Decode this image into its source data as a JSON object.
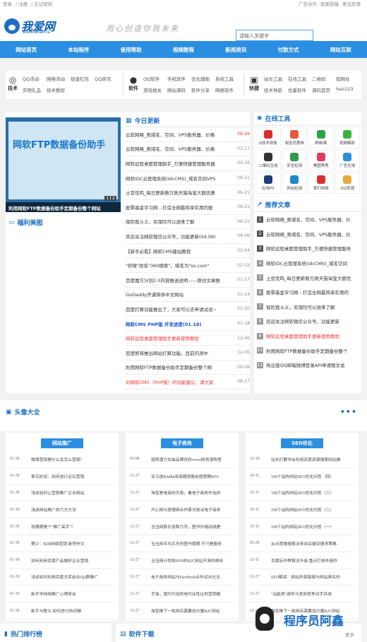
{
  "topbar": {
    "login": "登录",
    "register": "注册",
    "forgot": "忘记密码",
    "ad": "广告合作",
    "report": "我要投稿",
    "feedback": "意见反馈"
  },
  "header": {
    "brand": "我爱网",
    "url": "www.woail.la",
    "slogan": "用心创造你我未来",
    "search_placeholder": "请输入关键字"
  },
  "nav": [
    "网站首页",
    "本站程序",
    "使用帮助",
    "视频教程",
    "新闻资讯",
    "付款方式",
    "网站互联"
  ],
  "cats": [
    {
      "label": "技术",
      "links": [
        "QQ活动",
        "网络活动",
        "现金红包",
        "QQ资讯",
        "实物礼品",
        "技术教程"
      ]
    },
    {
      "label": "软件",
      "links": [
        "QQ软件",
        "手机软件",
        "优化辅助",
        "系统工具",
        "游戏相关",
        "网站源码",
        "软件分享",
        "网络软件"
      ]
    },
    {
      "label": "快捷",
      "links": [
        "站长工具",
        "在线工具",
        "二维码",
        "短网址",
        "技术导航",
        "优量软件",
        "源码首页",
        "hao123"
      ]
    }
  ],
  "slider": {
    "caption": "利用网软FTP数据备份助手定期备份整个网站",
    "banner1": "网软FTP数据备份助手",
    "dots": [
      "1",
      "2"
    ]
  },
  "news": {
    "title": "今日更新",
    "items": [
      {
        "t": "云软网络_奥域名、空间、VPS服务器、价格",
        "d": "08-26",
        "cls": "red"
      },
      {
        "t": "云软网络_奥域名、空间、VPS服务器、价格",
        "d": "03-17",
        "cls": ""
      },
      {
        "t": "网软远程桌面管理助手_方便快捷管理服务器",
        "d": "03-16",
        "cls": ""
      },
      {
        "t": "网软IDC云管理系统(idcCMS)_域名空间VPS",
        "d": "06-21",
        "cls": ""
      },
      {
        "t": "土豆优鸣_每日更新数万款天猫淘宝大额优惠",
        "d": "06-21",
        "cls": ""
      },
      {
        "t": "股票基金学习网 - 打造全网最简单实用的股",
        "d": "06-21",
        "cls": ""
      },
      {
        "t": "保险我斗义，买保险可以进来了解",
        "d": "06-21",
        "cls": ""
      },
      {
        "t": "欢迎关注网软微信公众号，功能更新(04.06)",
        "d": "04-06",
        "cls": ""
      },
      {
        "t": "【新手必看】网软CMS建站教程",
        "d": "03-04",
        "cls": ""
      },
      {
        "t": "\"好搜\"改名\"360搜索\"，域名为\"so.com\"",
        "d": "02-02",
        "cls": ""
      },
      {
        "t": "百度魔方计划2.0内容推送说明——原创文章推",
        "d": "01-27",
        "cls": ""
      },
      {
        "t": "GoDaddy开通简体中文网站",
        "d": "01-24",
        "cls": ""
      },
      {
        "t": "百度打算功能推出了，大家可以去申请试试~",
        "d": "01-20",
        "cls": ""
      },
      {
        "t": "网软CMS PHP版 开发进度(01.18)",
        "d": "01-18",
        "cls": "blue"
      },
      {
        "t": "网软远程桌面管理助手更新使用教程",
        "d": "12-06",
        "cls": "redt"
      },
      {
        "t": "百度即将推出网站打算功能，目前内测中",
        "d": "12-05",
        "cls": ""
      },
      {
        "t": "利用网软FTP数据备份助手定期备份整个网",
        "d": "09-08",
        "cls": ""
      },
      {
        "t": "对网软CMS（PHP版）的功能建议，请大家",
        "d": "08-27",
        "cls": "redt"
      }
    ]
  },
  "fuli": {
    "title": "福利美图"
  },
  "tools": {
    "title": "在线工具",
    "items": [
      {
        "l": "Q技术导航",
        "c": "#d93025"
      },
      {
        "l": "淘宝优惠券",
        "c": "#e8563b"
      },
      {
        "l": "刷绑课",
        "c": "#2aa34a"
      },
      {
        "l": "视频解析",
        "c": "#3cb43c"
      },
      {
        "l": "二维码生成",
        "c": "#333333"
      },
      {
        "l": "安全检测",
        "c": "#2e9b4a"
      },
      {
        "l": "美图秀秀",
        "c": "#e33a5f"
      },
      {
        "l": "广告生成",
        "c": "#2b8ee0"
      },
      {
        "l": "在线PS",
        "c": "#1f3f7a"
      },
      {
        "l": "网站检测",
        "c": "#1e88c8"
      },
      {
        "l": "我们网络",
        "c": "#d9302b"
      },
      {
        "l": "QQ资源",
        "c": "#e8a93b"
      }
    ]
  },
  "recommend": {
    "title": "推荐文章",
    "items": [
      {
        "n": "1",
        "t": "云软网络_奥域名、空间、VPS服务器、价"
      },
      {
        "n": "2",
        "t": "云软网络_奥域名、空间、VPS服务器、价"
      },
      {
        "n": "3",
        "t": "网软远程桌面管理助手_方便快捷管理服务"
      },
      {
        "n": "4",
        "t": "网软IDC云管理系统(idcCMS)_域名空间"
      },
      {
        "n": "5",
        "t": "土豆优鸣_每日更新数万款天猫淘宝大额优"
      },
      {
        "n": "6",
        "t": "股票基金学习网 - 打造全网最简单实用的"
      },
      {
        "n": "7",
        "t": "保险我斗义，买保险可以进来了解"
      },
      {
        "n": "8",
        "t": "欢迎关注网软微信公众号，功能更新"
      },
      {
        "n": "9",
        "t": "网软远程桌面管理助手更新使用教程"
      },
      {
        "n": "10",
        "t": "利用网软FTP数据备份助手定期备份整个"
      },
      {
        "n": "11",
        "t": "商业版QQ邮箱微博登录API申请图文说"
      }
    ]
  },
  "avatars": {
    "title": "头像大全",
    "more": "•••"
  },
  "col1": {
    "badge": "网站推广",
    "items": [
      {
        "d": "01-30",
        "t": "微博营销是什么及怎么营销?"
      },
      {
        "d": "01-30",
        "t": "草鸟好说：如何进行论坛营销"
      },
      {
        "d": "01-30",
        "t": "浅谈如何让营销推广企业网站"
      },
      {
        "d": "01-30",
        "t": "浅谈网站推广的六大方法"
      },
      {
        "d": "01-30",
        "t": "张德朗是个\"推广高手\"?"
      },
      {
        "d": "01-30",
        "t": "樊少：B2B网络营销 新势作文"
      },
      {
        "d": "01-30",
        "t": "如何利用百度产品做好企业营销"
      },
      {
        "d": "01-30",
        "t": "浅谈如何利用百度文库结合QQ群推广"
      },
      {
        "d": "01-30",
        "t": "新手学网络推广心得体会"
      },
      {
        "d": "01-30",
        "t": "新手与联义 如何进行热词做"
      }
    ]
  },
  "col2": {
    "badge": "电子商务",
    "items": [
      {
        "d": "03-08",
        "t": "强势潜力女装品牌优所vvwo即将强势登"
      },
      {
        "d": "12-27",
        "t": "亚马逊Kindle阅读器销售前超预期60%"
      },
      {
        "d": "12-27",
        "t": "淘宝是电商的大佬，看电子商务外包的"
      },
      {
        "d": "12-27",
        "t": "开心网与爱顺网合作首次尝试电子商务"
      },
      {
        "d": "12-27",
        "t": "当当网股价连跌六天，图书价格战成是"
      },
      {
        "d": "12-27",
        "t": "当当网平均五天的图书假期  不只是服务"
      },
      {
        "d": "12-27",
        "t": "当当网计划将60%的B2C网站开来的维长"
      },
      {
        "d": "12-27",
        "t": "电子商务网站与Facebook合作试水社交"
      },
      {
        "d": "12-27",
        "t": "手淘，国代代设的电代店性比的营销略"
      },
      {
        "d": "12-27",
        "t": "淘宝推下一批网店需要加分量B2C网站"
      }
    ]
  },
  "col3": {
    "badge": "SEO优化",
    "items": [
      {
        "d": "12-18",
        "t": "站长们要学会利用百度资源搜索网站推"
      },
      {
        "d": "10-11",
        "t": "100个站的网站SEO优化问答（四）"
      },
      {
        "d": "10-11",
        "t": "100个站的网站SEO优化问答（三）"
      },
      {
        "d": "10-11",
        "t": "100个站的网站SEO优化问答（二）"
      },
      {
        "d": "10-11",
        "t": "100个站的网站SEO优化问答（一）"
      },
      {
        "d": "03-20",
        "t": "从点度搜搜算法来谈关键词搜寻策略"
      },
      {
        "d": "12-11",
        "t": "百度反作弊算法升级 重点打击外链作"
      },
      {
        "d": "12-27",
        "t": "SEO解读：网站外部链接与网站排名的"
      },
      {
        "d": "12-27",
        "t": "\"站能表\"或呼与其他竞争对手并成"
      },
      {
        "d": "12-27",
        "t": "淘宝推下一批网店需要加分量B2C网站"
      }
    ]
  },
  "bottom": {
    "hot": "热门排行榜",
    "software": "软件下载",
    "more": "更多"
  },
  "watermark": {
    "text": "程序员阿鑫"
  }
}
